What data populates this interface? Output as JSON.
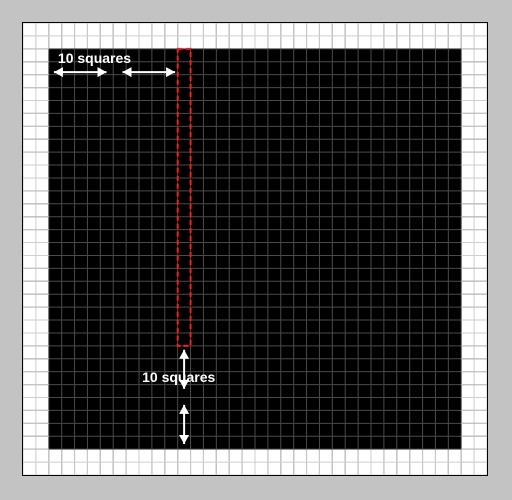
{
  "diagram": {
    "outer_cols": 36,
    "outer_rows": 35,
    "inner_margin_cells": 2,
    "selection": {
      "col_start": 12,
      "row_start": 2,
      "width_cells": 1,
      "height_cells": 23
    },
    "arrows": {
      "horizontal": {
        "label": "10 squares"
      },
      "vertical": {
        "label": "10 squares"
      }
    },
    "colors": {
      "outer_bg": "#c3c3c3",
      "panel_bg": "#ffffff",
      "inner_bg": "#000000",
      "grid_line_light": "#cfcfcf",
      "grid_line_dark": "#4a4a4a",
      "selection": "#ff1a1a",
      "text": "#ffffff"
    }
  }
}
